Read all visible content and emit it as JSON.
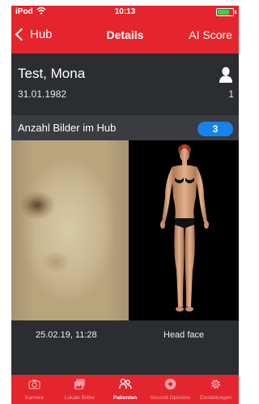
{
  "status_bar": {
    "carrier": "iPod",
    "time": "10:13"
  },
  "nav": {
    "back_label": "Hub",
    "title": "Details",
    "right_label": "AI Score"
  },
  "patient": {
    "name": "Test, Mona",
    "dob": "31.01.1982",
    "number": "1"
  },
  "count_row": {
    "label": "Anzahl Bilder im Hub",
    "count": "3"
  },
  "image_entry": {
    "date": "25.02.19, 11:28",
    "region": "Head face"
  },
  "tabs": [
    {
      "label": "Kamera",
      "icon": "camera-icon",
      "active": false
    },
    {
      "label": "Lokale Bilder",
      "icon": "photos-icon",
      "active": false
    },
    {
      "label": "Patienten",
      "icon": "patients-icon",
      "active": true
    },
    {
      "label": "Second Opinions",
      "icon": "second-opinions-icon",
      "active": false
    },
    {
      "label": "Einstellungen",
      "icon": "gear-icon",
      "active": false
    }
  ],
  "colors": {
    "brand_red": "#e4252d",
    "badge_blue": "#1683ec",
    "panel": "#2b2d31"
  }
}
